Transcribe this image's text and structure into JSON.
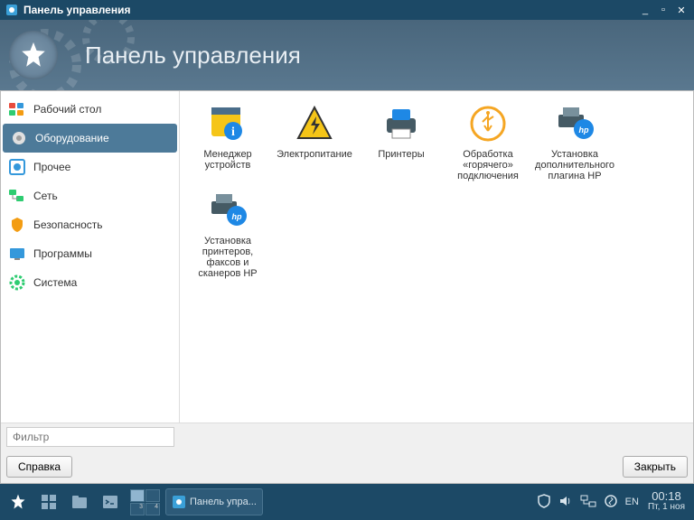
{
  "titlebar": {
    "title": "Панель управления"
  },
  "header": {
    "title": "Панель управления"
  },
  "sidebar": {
    "items": [
      {
        "id": "desktop",
        "label": "Рабочий стол",
        "active": false
      },
      {
        "id": "hardware",
        "label": "Оборудование",
        "active": true
      },
      {
        "id": "other",
        "label": "Прочее",
        "active": false
      },
      {
        "id": "network",
        "label": "Сеть",
        "active": false
      },
      {
        "id": "security",
        "label": "Безопасность",
        "active": false
      },
      {
        "id": "programs",
        "label": "Программы",
        "active": false
      },
      {
        "id": "system",
        "label": "Система",
        "active": false
      }
    ]
  },
  "content": {
    "items": [
      {
        "id": "device-manager",
        "label": "Менеджер устройств"
      },
      {
        "id": "power",
        "label": "Электропитание"
      },
      {
        "id": "printers",
        "label": "Принтеры"
      },
      {
        "id": "hotplug",
        "label": "Обработка «горячего» подключения"
      },
      {
        "id": "hp-plugin",
        "label": "Установка дополнительного плагина HP"
      },
      {
        "id": "hp-setup",
        "label": "Установка принтеров, факсов и сканеров HP"
      }
    ]
  },
  "filter": {
    "placeholder": "Фильтр"
  },
  "buttons": {
    "help": "Справка",
    "close": "Закрыть"
  },
  "taskbar": {
    "app_label": "Панель упра...",
    "lang": "EN",
    "time": "00:18",
    "date": "Пт, 1 ноя"
  }
}
